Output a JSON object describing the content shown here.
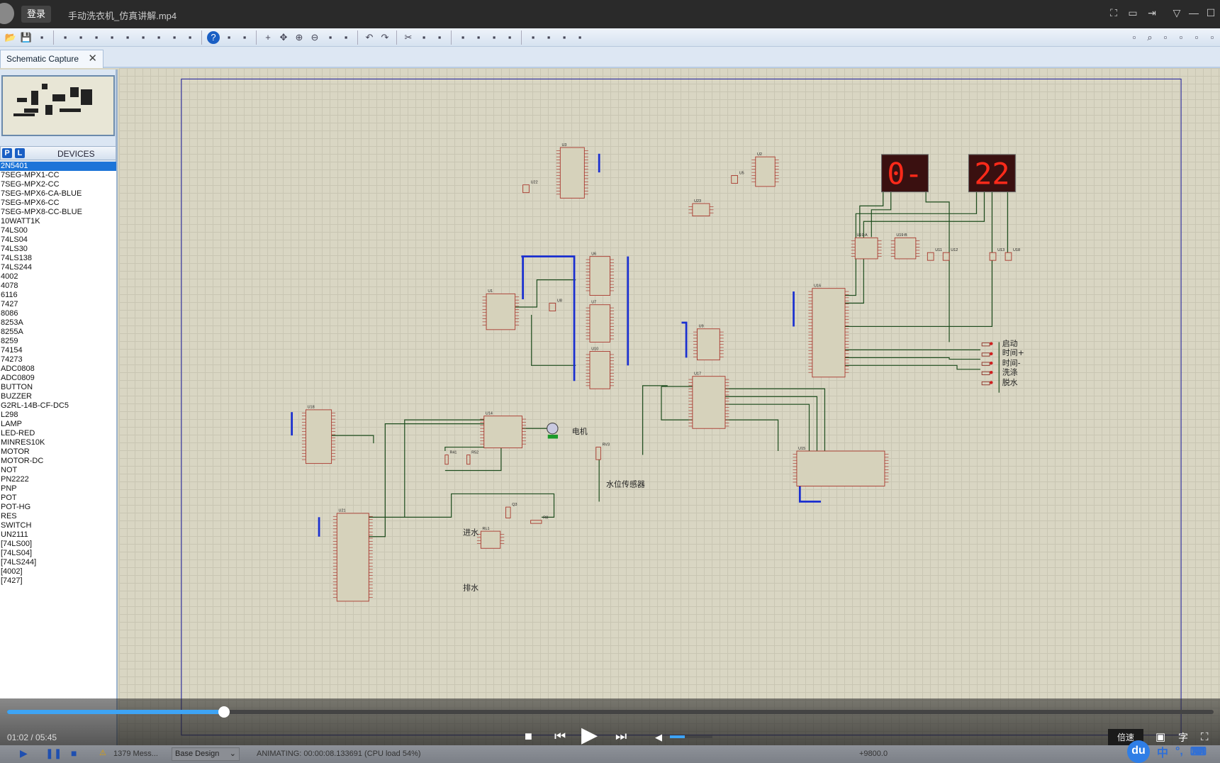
{
  "titlebar": {
    "login": "登录",
    "video_title": "手动洗衣机_仿真讲解.mp4"
  },
  "toolbar": {
    "icons": [
      "open-icon",
      "save-icon",
      "import-icon",
      "home-icon",
      "component-icon",
      "chip-icon",
      "back-icon",
      "netlist-icon",
      "pcb-icon",
      "bom-icon",
      "gerber-icon",
      "doc-icon",
      "help-icon",
      "refresh-icon",
      "grid-icon",
      "origin-icon",
      "pan-icon",
      "zoom-in-icon",
      "zoom-out-icon",
      "zoom-all-icon",
      "zoom-area-icon",
      "undo-icon",
      "redo-icon",
      "cut-icon",
      "copy-icon",
      "paste-icon",
      "block-copy-icon",
      "block-move-icon",
      "block-rotate-icon",
      "block-delete-icon",
      "pick-icon",
      "make-device-icon",
      "packaging-tool-icon",
      "decompose-icon"
    ],
    "right_icons": [
      "wire-autoroute-icon",
      "search-icon",
      "property-tool-icon",
      "new-sheet-icon",
      "delete-sheet-icon",
      "exit-sheet-icon"
    ]
  },
  "tab": {
    "label": "Schematic Capture"
  },
  "devices": {
    "p_label": "P",
    "l_label": "L",
    "title": "DEVICES",
    "selected": 0,
    "items": [
      "2N5401",
      "7SEG-MPX1-CC",
      "7SEG-MPX2-CC",
      "7SEG-MPX6-CA-BLUE",
      "7SEG-MPX6-CC",
      "7SEG-MPX8-CC-BLUE",
      "10WATT1K",
      "74LS00",
      "74LS04",
      "74LS30",
      "74LS138",
      "74LS244",
      "4002",
      "4078",
      "6116",
      "7427",
      "8086",
      "8253A",
      "8255A",
      "8259",
      "74154",
      "74273",
      "ADC0808",
      "ADC0809",
      "BUTTON",
      "BUZZER",
      "G2RL-14B-CF-DC5",
      "L298",
      "LAMP",
      "LED-RED",
      "MINRES10K",
      "MOTOR",
      "MOTOR-DC",
      "NOT",
      "PN2222",
      "PNP",
      "POT",
      "POT-HG",
      "RES",
      "SWITCH",
      "UN2111",
      "[74LS00]",
      "[74LS04]",
      "[74LS244]",
      "[4002]",
      "[7427]"
    ]
  },
  "schematic": {
    "wire_color": "#1e4d1e",
    "bus_color": "#1a2fd0",
    "chip_fill": "#d6d2bb",
    "chip_border": "#a8342a",
    "display_left": "0-",
    "display_right": "22",
    "chips": [
      "U3",
      "U2",
      "U23",
      "U1",
      "U6",
      "U7",
      "U10",
      "U9",
      "U16",
      "U17",
      "U15",
      "U19:A",
      "U19:B",
      "U18",
      "U14",
      "U21",
      "RL1",
      "U5",
      "U22",
      "U8",
      "U11",
      "U12",
      "U13",
      "U18",
      "RV3",
      "Q3",
      "R8",
      "R41",
      "R52"
    ],
    "labels": {
      "start": "启动",
      "time_plus": "时间+",
      "time_minus": "时间-",
      "wash": "洗涤",
      "spin": "脱水",
      "motor": "电机",
      "water_sensor": "水位传感器",
      "inlet": "进水",
      "drain": "排水"
    }
  },
  "video": {
    "time": "01:02 / 05:45",
    "progress_percent": 18,
    "volume_percent": 35,
    "speed": "倍速",
    "subtitle": "字"
  },
  "statusbar": {
    "messages": "1379 Mess...",
    "design": "Base Design",
    "status": "ANIMATING: 00:00:08.133691 (CPU load 54%)",
    "coord": "+9800.0"
  },
  "ime": {
    "logo": "du",
    "lang": "中",
    "punct": "°,"
  }
}
